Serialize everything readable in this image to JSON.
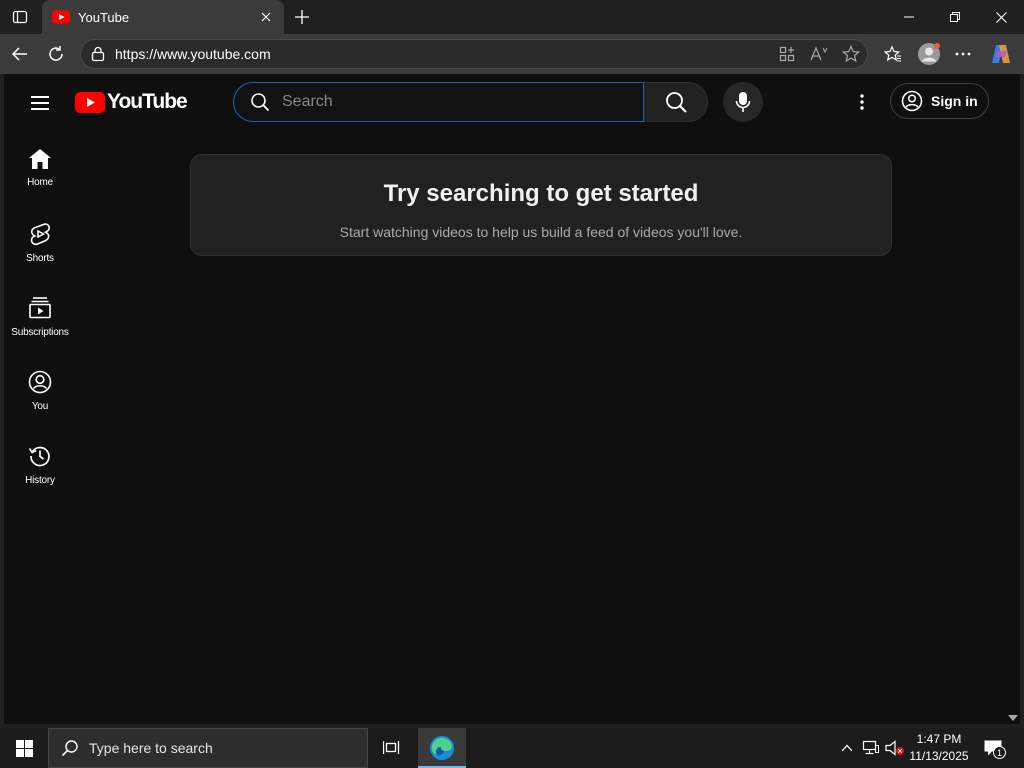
{
  "browser": {
    "tab_title": "YouTube",
    "url": "https://www.youtube.com"
  },
  "masthead": {
    "logo_text": "YouTube",
    "search_placeholder": "Search",
    "signin_label": "Sign in"
  },
  "guide": {
    "items": [
      {
        "label": "Home",
        "icon": "home-icon"
      },
      {
        "label": "Shorts",
        "icon": "shorts-icon"
      },
      {
        "label": "Subscriptions",
        "icon": "subscriptions-icon"
      },
      {
        "label": "You",
        "icon": "you-icon"
      },
      {
        "label": "History",
        "icon": "history-icon"
      }
    ]
  },
  "promo": {
    "title": "Try searching to get started",
    "subtitle": "Start watching videos to help us build a feed of videos you'll love."
  },
  "taskbar": {
    "search_text": "Type here to search",
    "time": "1:47 PM",
    "date": "11/13/2025",
    "notification_count": "1"
  },
  "colors": {
    "youtube_red": "#ff0000",
    "search_focus_border": "#1c62b9",
    "page_background": "#0f0f0f"
  }
}
